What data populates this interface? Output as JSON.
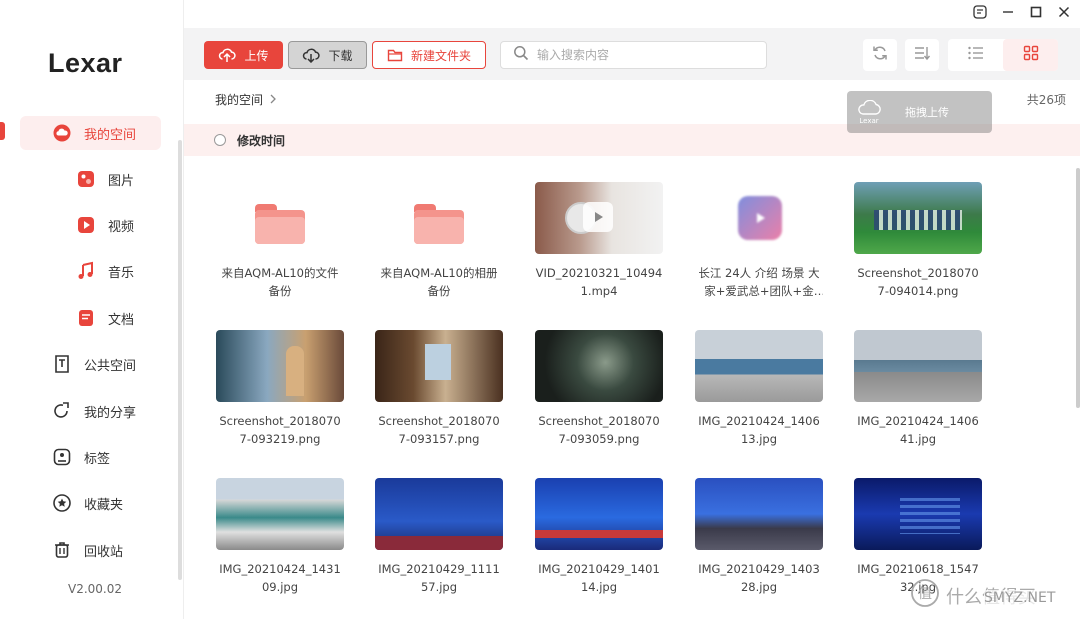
{
  "app": {
    "brand": "Lexar",
    "version": "V2.00.02"
  },
  "sidebar": {
    "items": [
      {
        "label": "我的空间"
      },
      {
        "label": "图片"
      },
      {
        "label": "视频"
      },
      {
        "label": "音乐"
      },
      {
        "label": "文档"
      },
      {
        "label": "公共空间"
      },
      {
        "label": "我的分享"
      },
      {
        "label": "标签"
      },
      {
        "label": "收藏夹"
      },
      {
        "label": "回收站"
      }
    ]
  },
  "toolbar": {
    "upload_label": "上传",
    "download_label": "下载",
    "new_folder_label": "新建文件夹",
    "search_placeholder": "输入搜索内容"
  },
  "path": {
    "breadcrumb": "我的空间",
    "count": "共26项"
  },
  "drag_overlay": {
    "brand": "Lexar",
    "label": "拖拽上传"
  },
  "sort": {
    "label": "修改时间"
  },
  "files": [
    {
      "name": "来自AQM-AL10的文件备份",
      "type": "folder"
    },
    {
      "name": "来自AQM-AL10的相册备份",
      "type": "folder"
    },
    {
      "name": "VID_20210321_104941.mp4",
      "type": "video-thumb"
    },
    {
      "name": "长江 24人 介绍 场景 大家+爱武总+团队+金琳...",
      "type": "video-file"
    },
    {
      "name": "Screenshot_20180707-094014.png",
      "type": "image"
    },
    {
      "name": "Screenshot_20180707-093219.png",
      "type": "image"
    },
    {
      "name": "Screenshot_20180707-093157.png",
      "type": "image"
    },
    {
      "name": "Screenshot_20180707-093059.png",
      "type": "image"
    },
    {
      "name": "IMG_20210424_140613.jpg",
      "type": "image"
    },
    {
      "name": "IMG_20210424_140641.jpg",
      "type": "image"
    },
    {
      "name": "IMG_20210424_143109.jpg",
      "type": "image"
    },
    {
      "name": "IMG_20210429_111157.jpg",
      "type": "image"
    },
    {
      "name": "IMG_20210429_140114.jpg",
      "type": "image"
    },
    {
      "name": "IMG_20210429_140328.jpg",
      "type": "image"
    },
    {
      "name": "IMG_20210618_154732.jpg",
      "type": "image"
    }
  ],
  "watermark": {
    "text": "什么值得买",
    "site": "SMYZ.NET"
  },
  "colors": {
    "accent": "#e8453c",
    "accent_light": "#fdeeee"
  }
}
